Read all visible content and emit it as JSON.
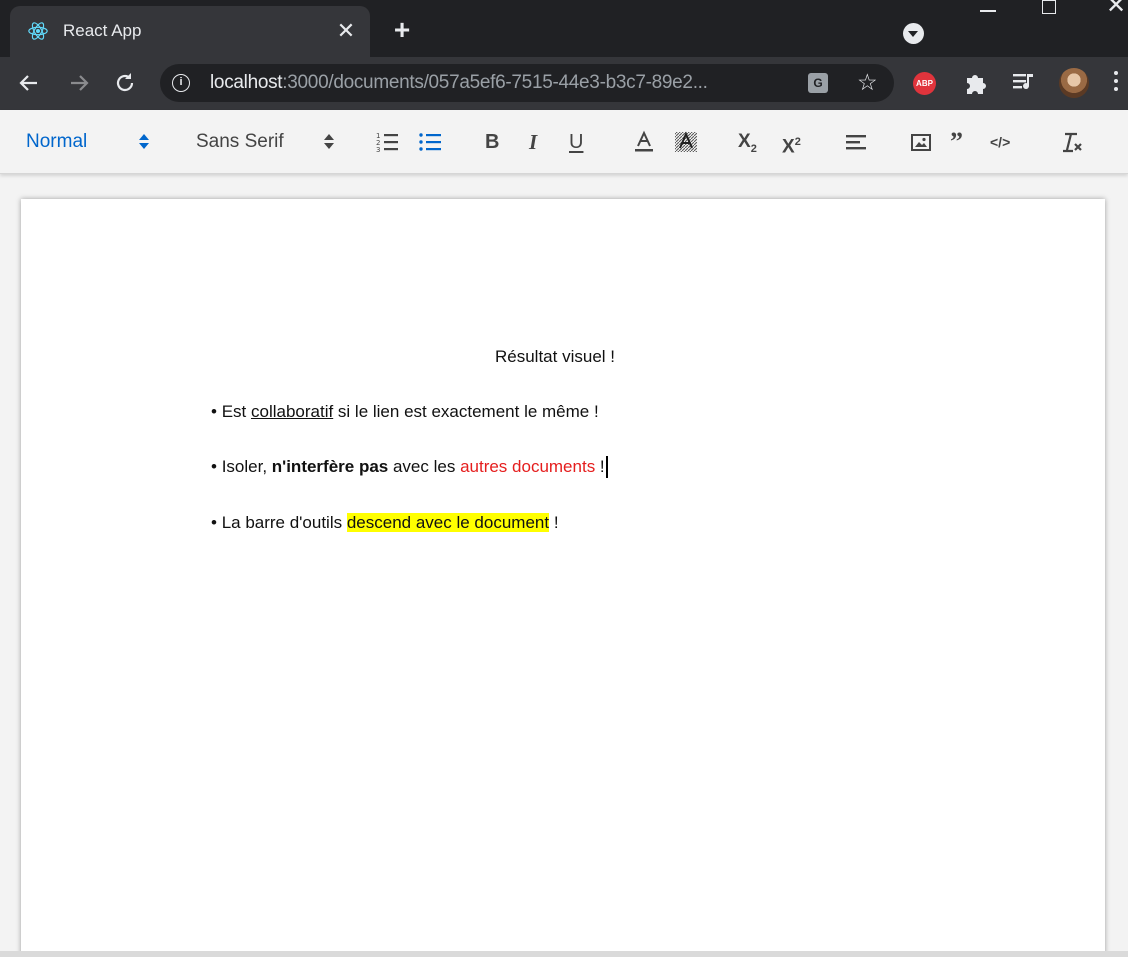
{
  "browser": {
    "tab": {
      "title": "React App",
      "close_glyph": "✕"
    },
    "new_tab_glyph": "+",
    "url": {
      "host": "localhost",
      "path": ":3000/documents/057a5ef6-7515-44e3-b3c7-89e2..."
    },
    "extensions": {
      "abp_label": "ABP"
    },
    "icons": [
      "react-favicon-icon",
      "back-arrow-icon",
      "forward-arrow-icon",
      "reload-icon",
      "info-icon",
      "translate-icon",
      "star-icon",
      "puzzle-icon",
      "media-queue-icon",
      "kebab-menu-icon"
    ]
  },
  "toolbar": {
    "header_select": "Normal",
    "font_select": "Sans Serif",
    "bold": "B",
    "italic": "I",
    "underline": "U",
    "accent_color": "#0066cc"
  },
  "document": {
    "title": "Résultat visuel !",
    "lines": [
      {
        "bullet": "• ",
        "pre": "Est ",
        "underlined": "collaboratif",
        "post": " si le lien est exactement le même !"
      },
      {
        "bullet": "• ",
        "pre": "Isoler, ",
        "bold": "n'interfère pas",
        "mid": " avec les ",
        "red": "autres documents",
        "post": " !"
      },
      {
        "bullet": "• ",
        "pre": "La barre d'outils ",
        "highlight": "descend avec le document",
        "post": " !"
      }
    ]
  },
  "colors": {
    "red_text": "#e51d1d",
    "highlight": "#ffff00"
  }
}
